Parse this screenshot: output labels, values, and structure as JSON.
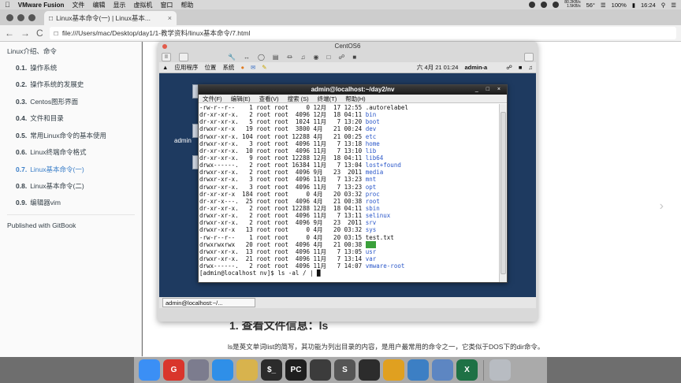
{
  "menubar": {
    "apple": "",
    "app_name": "VMware Fusion",
    "items": [
      "文件",
      "编辑",
      "显示",
      "虚拟机",
      "窗口",
      "帮助"
    ],
    "network_up": "80.2KB/s",
    "network_down": "1.5KB/s",
    "temperature": "56°",
    "battery": "100%",
    "time": "16:24"
  },
  "browser": {
    "tab_title": "Linux基本命令(一) | Linux基本...",
    "tab_close": "×",
    "url": "file:///Users/mac/Desktop/day1/1-教学资料/linux基本命令/7.html",
    "nav_back": "←",
    "nav_forward": "→",
    "nav_reload": "C"
  },
  "sidebar": {
    "root_label": "Linux介绍、命令",
    "items": [
      {
        "num": "0.1.",
        "label": "操作系统"
      },
      {
        "num": "0.2.",
        "label": "操作系统的发展史"
      },
      {
        "num": "0.3.",
        "label": "Centos图形界面"
      },
      {
        "num": "0.4.",
        "label": "文件和目录"
      },
      {
        "num": "0.5.",
        "label": "常用Linux命令的基本使用"
      },
      {
        "num": "0.6.",
        "label": "Linux终端命令格式"
      },
      {
        "num": "0.7.",
        "label": "Linux基本命令(一)"
      },
      {
        "num": "0.8.",
        "label": "Linux基本命令(二)"
      },
      {
        "num": "0.9.",
        "label": "编辑器vim"
      }
    ],
    "publish": "Published with GitBook"
  },
  "content": {
    "heading": "1. 查看文件信息：ls",
    "paragraph": "ls是英文单词list的简写，其功能为列出目录的内容，是用户最常用的命令之一，它类似于DOS下的dir命令。",
    "next_arrow": "›"
  },
  "vmware": {
    "title": "CentOS6",
    "tool_pause": "II"
  },
  "gnome": {
    "menus": [
      "应用程序",
      "位置",
      "系统"
    ],
    "clock": "六 4月 21 01:24",
    "user": "admin-a",
    "desktop_label": "admin",
    "taskbar_item": "admin@localhost:~/..."
  },
  "terminal": {
    "title": "admin@localhost:~/day2/nv",
    "controls": "_ □ ×",
    "menu": [
      "文件(F)",
      "编辑(E)",
      "查看(V)",
      "搜索 (S)",
      "终端(T)",
      "帮助(H)"
    ],
    "rows": [
      {
        "meta": "-rw-r--r--    1 root root     0 12月  17 12:55 ",
        "name": ".autorelabel",
        "dir": false
      },
      {
        "meta": "dr-xr-xr-x.   2 root root  4096 12月  18 04:11 ",
        "name": "bin",
        "dir": true
      },
      {
        "meta": "dr-xr-xr-x.   5 root root  1024 11月   7 13:20 ",
        "name": "boot",
        "dir": true
      },
      {
        "meta": "drwxr-xr-x   19 root root  3800 4月   21 00:24 ",
        "name": "dev",
        "dir": true
      },
      {
        "meta": "drwxr-xr-x. 104 root root 12288 4月   21 00:25 ",
        "name": "etc",
        "dir": true
      },
      {
        "meta": "drwxr-xr-x.   3 root root  4096 11月   7 13:18 ",
        "name": "home",
        "dir": true
      },
      {
        "meta": "dr-xr-xr-x.  10 root root  4096 11月   7 13:10 ",
        "name": "lib",
        "dir": true
      },
      {
        "meta": "dr-xr-xr-x.   9 root root 12288 12月  18 04:11 ",
        "name": "lib64",
        "dir": true
      },
      {
        "meta": "drwx------.   2 root root 16384 11月   7 13:04 ",
        "name": "lost+found",
        "dir": true
      },
      {
        "meta": "drwxr-xr-x.   2 root root  4096 9月   23  2011 ",
        "name": "media",
        "dir": true
      },
      {
        "meta": "drwxr-xr-x.   3 root root  4096 11月   7 13:23 ",
        "name": "mnt",
        "dir": true
      },
      {
        "meta": "drwxr-xr-x.   3 root root  4096 11月   7 13:23 ",
        "name": "opt",
        "dir": true
      },
      {
        "meta": "dr-xr-xr-x  184 root root     0 4月   20 03:32 ",
        "name": "proc",
        "dir": true
      },
      {
        "meta": "dr-xr-x---.  25 root root  4096 4月   21 00:38 ",
        "name": "root",
        "dir": true
      },
      {
        "meta": "dr-xr-xr-x.   2 root root 12288 12月  18 04:11 ",
        "name": "sbin",
        "dir": true
      },
      {
        "meta": "drwxr-xr-x.   2 root root  4096 11月   7 13:11 ",
        "name": "selinux",
        "dir": true
      },
      {
        "meta": "drwxr-xr-x.   2 root root  4096 9月   23  2011 ",
        "name": "srv",
        "dir": true
      },
      {
        "meta": "drwxr-xr-x   13 root root     0 4月   20 03:32 ",
        "name": "sys",
        "dir": true
      },
      {
        "meta": "-rw-r--r--    1 root root     0 4月   20 03:15 ",
        "name": "test.txt",
        "dir": false
      },
      {
        "meta": "drwxrwxrwx   20 root root  4096 4月   21 00:38 ",
        "name": "tmp",
        "dir": "hl"
      },
      {
        "meta": "drwxr-xr-x.  13 root root  4096 11月   7 13:05 ",
        "name": "usr",
        "dir": true
      },
      {
        "meta": "drwxr-xr-x.  21 root root  4096 11月   7 13:14 ",
        "name": "var",
        "dir": true
      },
      {
        "meta": "drwx------.   2 root root  4096 11月   7 14:07 ",
        "name": "vmware-root",
        "dir": true
      }
    ],
    "prompt": "[admin@localhost nv]$ ls -al / | ",
    "cursor": "█"
  },
  "dock": {
    "apps": [
      {
        "name": "finder",
        "color": "#3b8ff5",
        "glyph": ""
      },
      {
        "name": "app-g",
        "color": "#d9352b",
        "glyph": "G"
      },
      {
        "name": "launchpad",
        "color": "#7c7c8e",
        "glyph": ""
      },
      {
        "name": "safari",
        "color": "#2f8fe8",
        "glyph": ""
      },
      {
        "name": "editor",
        "color": "#d8b34d",
        "glyph": ""
      },
      {
        "name": "terminal",
        "color": "#2b2b2b",
        "glyph": "$_"
      },
      {
        "name": "pycharm",
        "color": "#1f1f1f",
        "glyph": "PC"
      },
      {
        "name": "screenshot",
        "color": "#3c3c3c",
        "glyph": ""
      },
      {
        "name": "sublime",
        "color": "#555555",
        "glyph": "S"
      },
      {
        "name": "obs",
        "color": "#2c2c2c",
        "glyph": ""
      },
      {
        "name": "chrome",
        "color": "#e0a020",
        "glyph": ""
      },
      {
        "name": "app-cube",
        "color": "#3c7fc4",
        "glyph": ""
      },
      {
        "name": "vmware",
        "color": "#5d86c2",
        "glyph": ""
      },
      {
        "name": "excel",
        "color": "#1e7145",
        "glyph": "X"
      },
      {
        "name": "trash",
        "color": "#b8bcc2",
        "glyph": ""
      }
    ]
  }
}
